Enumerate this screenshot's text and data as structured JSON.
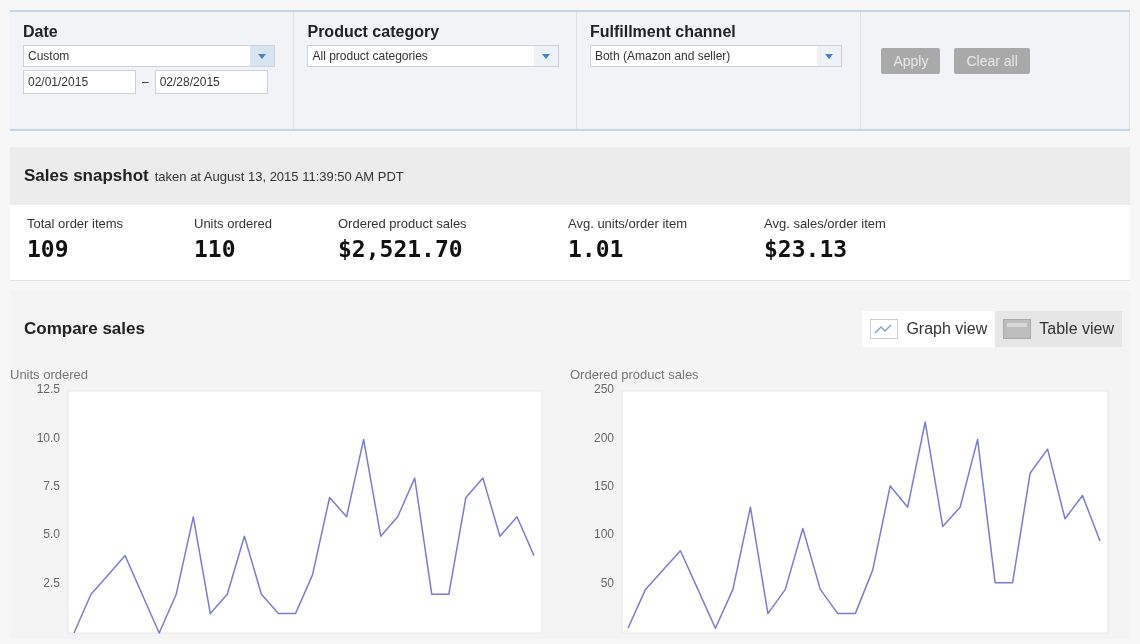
{
  "filters": [
    {
      "label": "Date",
      "dropdown": "Custom",
      "date_from": "02/01/2015",
      "date_separator": "–",
      "date_to": "02/28/2015"
    },
    {
      "label": "Product category",
      "dropdown": "All product categories"
    },
    {
      "label": "Fulfillment channel",
      "dropdown": "Both (Amazon and seller)"
    }
  ],
  "filter_buttons": [
    {
      "label": "Apply",
      "disabled": true
    },
    {
      "label": "Clear all",
      "disabled": true
    }
  ],
  "snapshot": {
    "title": "Sales snapshot",
    "subtitle": "taken at August 13, 2015 11:39:50 AM PDT",
    "metrics": [
      {
        "label": "Total order items",
        "value": "109"
      },
      {
        "label": "Units ordered",
        "value": "110"
      },
      {
        "label": "Ordered product sales",
        "value": "$2,521.70"
      },
      {
        "label": "Avg. units/order item",
        "value": "1.01"
      },
      {
        "label": "Avg. sales/order item",
        "value": "$23.13"
      }
    ]
  },
  "compare": {
    "title": "Compare sales",
    "views": [
      {
        "label": "Graph view",
        "kind": "graph",
        "selected": true
      },
      {
        "label": "Table view",
        "kind": "table",
        "selected": false
      }
    ],
    "charts": [
      {
        "chart_data": {
          "type": "line",
          "ylabel": "Units ordered",
          "ylim": [
            0,
            12.5
          ],
          "yticks": [
            {
              "value": 2.5,
              "label": "2.5"
            },
            {
              "value": 5,
              "label": "5.0"
            },
            {
              "value": 7.5,
              "label": "7.5"
            },
            {
              "value": 10,
              "label": "10.0"
            },
            {
              "value": 12.5,
              "label": "12.5"
            }
          ],
          "series": [
            {
              "color": "#7b7bd6",
              "values": [
                0,
                2,
                3,
                4,
                2,
                0,
                2,
                6,
                1,
                2,
                5,
                2,
                1,
                1,
                3,
                7,
                6,
                10,
                5,
                6,
                8,
                2,
                2,
                7,
                8,
                5,
                6,
                4
              ]
            }
          ]
        }
      },
      {
        "chart_data": {
          "type": "line",
          "ylabel": "Ordered product sales",
          "ylim": [
            0,
            250
          ],
          "yticks": [
            50,
            100,
            150,
            200,
            250
          ],
          "series": [
            {
              "color": "#7b7bd6",
              "values": [
                5,
                45,
                65,
                85,
                45,
                5,
                45,
                130,
                20,
                45,
                108,
                45,
                20,
                20,
                65,
                152,
                130,
                218,
                110,
                130,
                200,
                52,
                52,
                165,
                190,
                118,
                142,
                95
              ]
            }
          ]
        }
      }
    ]
  }
}
